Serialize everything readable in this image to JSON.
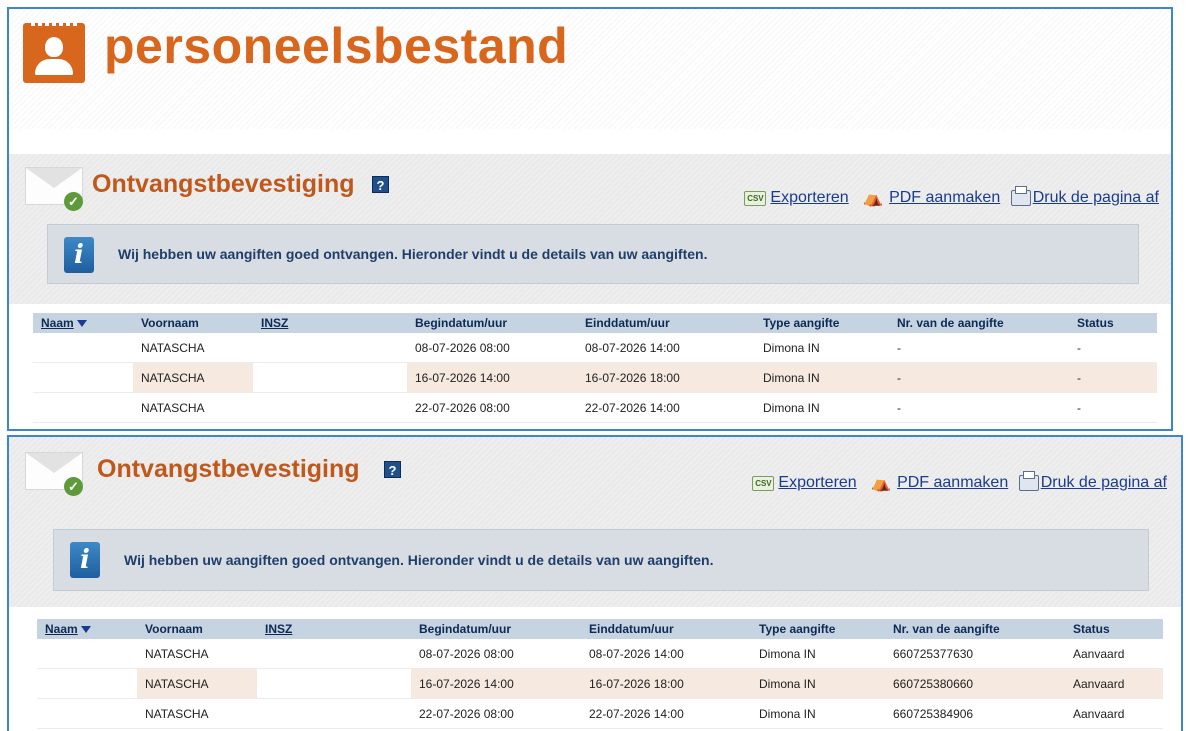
{
  "brand": {
    "title": "personeelsbestand"
  },
  "colors": {
    "accent_orange": "#d9661d",
    "title_orange": "#c0571b",
    "border_blue": "#3d86c8",
    "header_bg": "#c6d3e0",
    "alt_row": "#f6e9e0"
  },
  "sections": [
    {
      "title": "Ontvangstbevestiging",
      "help_icon": "?",
      "actions": {
        "export": "Exporteren",
        "pdf": "PDF aanmaken",
        "print": "Druk de pagina af"
      },
      "info": "Wij hebben uw aangiften goed ontvangen. Hieronder vindt u de details van uw aangiften.",
      "columns": [
        "Naam",
        "Voornaam",
        "INSZ",
        "Begindatum/uur",
        "Einddatum/uur",
        "Type aangifte",
        "Nr. van de aangifte",
        "Status"
      ],
      "rows": [
        {
          "naam": "",
          "voornaam": "NATASCHA",
          "insz": "",
          "begin": "08-07-2026 08:00",
          "einde": "08-07-2026 14:00",
          "type": "Dimona IN",
          "nr": "-",
          "status": "-"
        },
        {
          "naam": "",
          "voornaam": "NATASCHA",
          "insz": "",
          "begin": "16-07-2026 14:00",
          "einde": "16-07-2026 18:00",
          "type": "Dimona IN",
          "nr": "-",
          "status": "-"
        },
        {
          "naam": "",
          "voornaam": "NATASCHA",
          "insz": "",
          "begin": "22-07-2026 08:00",
          "einde": "22-07-2026 14:00",
          "type": "Dimona IN",
          "nr": "-",
          "status": "-"
        }
      ]
    },
    {
      "title": "Ontvangstbevestiging",
      "help_icon": "?",
      "actions": {
        "export": "Exporteren",
        "pdf": "PDF aanmaken",
        "print": "Druk de pagina af"
      },
      "info": "Wij hebben uw aangiften goed ontvangen. Hieronder vindt u de details van uw aangiften.",
      "columns": [
        "Naam",
        "Voornaam",
        "INSZ",
        "Begindatum/uur",
        "Einddatum/uur",
        "Type aangifte",
        "Nr. van de aangifte",
        "Status"
      ],
      "rows": [
        {
          "naam": "",
          "voornaam": "NATASCHA",
          "insz": "",
          "begin": "08-07-2026 08:00",
          "einde": "08-07-2026 14:00",
          "type": "Dimona IN",
          "nr": "660725377630",
          "status": "Aanvaard"
        },
        {
          "naam": "",
          "voornaam": "NATASCHA",
          "insz": "",
          "begin": "16-07-2026 14:00",
          "einde": "16-07-2026 18:00",
          "type": "Dimona IN",
          "nr": "660725380660",
          "status": "Aanvaard"
        },
        {
          "naam": "",
          "voornaam": "NATASCHA",
          "insz": "",
          "begin": "22-07-2026 08:00",
          "einde": "22-07-2026 14:00",
          "type": "Dimona IN",
          "nr": "660725384906",
          "status": "Aanvaard"
        }
      ]
    }
  ]
}
